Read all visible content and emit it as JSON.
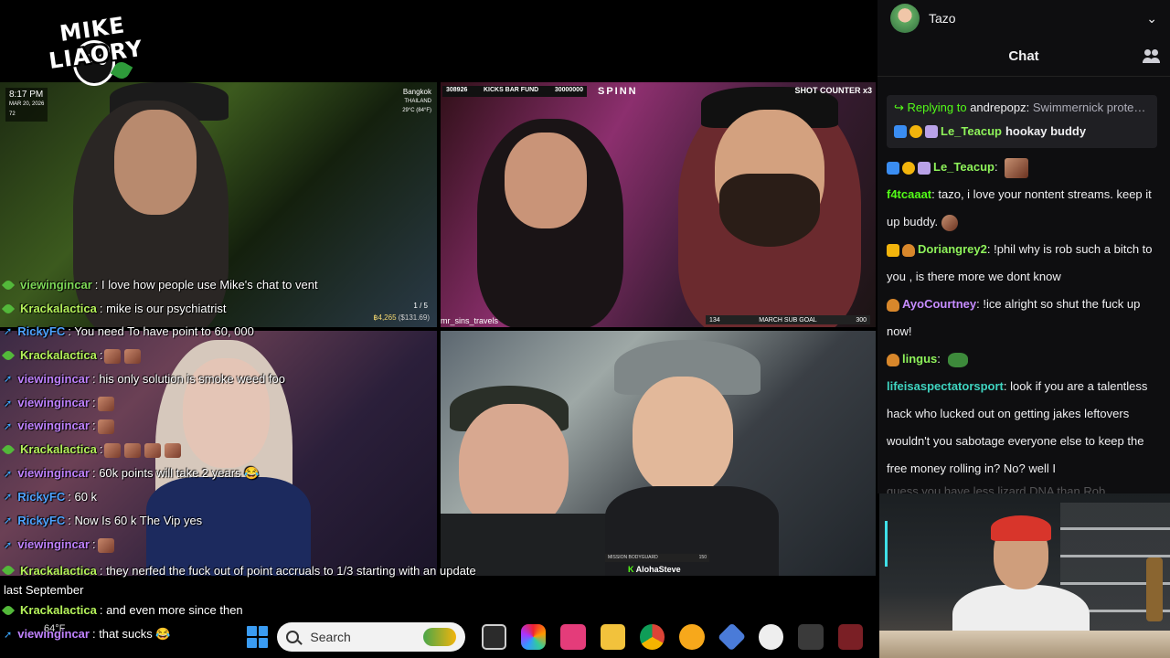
{
  "logo": {
    "text": "MIKE LIAORY"
  },
  "feed1": {
    "time": "8:17 PM",
    "date": "MAR 20, 2026",
    "viewers": "72",
    "city": "Bangkok",
    "country": "THAILAND",
    "temp": "29°C (84°F)",
    "pages": "1 / 5",
    "money": "฿4,265",
    "money_usd": "($131.69)"
  },
  "feed2": {
    "fund_num": "308926",
    "fund_label": "KICKS BAR FUND",
    "fund_goal": "30000000",
    "sign": "SPINN",
    "shot_counter": "SHOT COUNTER  x3",
    "handle": "mr_sins_travels",
    "subgoal_left": "134",
    "subgoal_label": "MARCH SUB GOAL",
    "subgoal_right": "300"
  },
  "feed4": {
    "mission_label": "MISSION BODYGUARD",
    "mission_val": "150",
    "streamer": "AlohaSteve"
  },
  "overlay_chat": [
    {
      "user": "viewingincar",
      "text": ": I love how people use Mike's chat to vent",
      "color": "u-green",
      "icon": "leaf"
    },
    {
      "user": "Krackalactica",
      "text": ": mike is our psychiatrist",
      "color": "u-lime",
      "icon": "leaf"
    },
    {
      "user": "RickyFC",
      "text": ": You need To have point to 60, 000",
      "color": "u-blue",
      "icon": "arrow"
    },
    {
      "user": "Krackalactica",
      "text": ":",
      "color": "u-lime",
      "icon": "leaf"
    },
    {
      "user": "viewingincar",
      "text": ": his only solution is smoke weed foo",
      "color": "u-purple",
      "icon": "arrow"
    },
    {
      "user": "viewingincar",
      "text": ":",
      "color": "u-purple",
      "icon": "arrow"
    },
    {
      "user": "viewingincar",
      "text": ":",
      "color": "u-purple",
      "icon": "arrow"
    },
    {
      "user": "Krackalactica",
      "text": ":",
      "color": "u-lime",
      "icon": "leaf"
    },
    {
      "user": "viewingincar",
      "text": ": 60k points will take 2 years 😂",
      "color": "u-purple",
      "icon": "arrow"
    },
    {
      "user": "RickyFC",
      "text": ": 60 k",
      "color": "u-blue",
      "icon": "arrow"
    },
    {
      "user": "RickyFC",
      "text": ": Now Is 60 k The Vip yes",
      "color": "u-blue",
      "icon": "arrow"
    },
    {
      "user": "viewingincar",
      "text": ":",
      "color": "u-purple",
      "icon": "arrow"
    },
    {
      "user": "Krackalactica",
      "text": ": they nerfed the fuck out of point accruals to 1/3 starting with an update last September",
      "color": "u-lime",
      "icon": "leaf"
    },
    {
      "user": "Krackalactica",
      "text": ": and even more since then",
      "color": "u-lime",
      "icon": "leaf"
    },
    {
      "user": "viewingincar",
      "text": ": that sucks 😂",
      "color": "u-purple",
      "icon": "arrow"
    }
  ],
  "weather": {
    "temp": "64°F"
  },
  "taskbar": {
    "search_placeholder": "Search"
  },
  "chat": {
    "account_name": "Tazo",
    "title": "Chat",
    "reply_prefix": "Replying to",
    "reply_to": "andrepopz:",
    "reply_ref": "Swimmernick protects...",
    "reply_user": "Le_Teacup",
    "reply_text": "hookay buddy",
    "messages": [
      {
        "user": "Le_Teacup",
        "text": "",
        "color": "n-lime"
      },
      {
        "user": "f4tcaaat",
        "text": "tazo, i love your nontent streams. keep it up buddy.",
        "color": "n-green"
      },
      {
        "user": "Doriangrey2",
        "text": "!phil why is rob such a bitch to you , is there more we dont know",
        "color": "n-lime"
      },
      {
        "user": "AyoCourtney",
        "text": "!ice alright so shut the fuck up now!",
        "color": "n-purple"
      },
      {
        "user": "lingus",
        "text": "",
        "color": "n-lime"
      },
      {
        "user": "lifeisaspectatorsport",
        "text": "look if you are a talentless hack who lucked out on getting jakes leftovers wouldn't you sabotage everyone else to keep the free money rolling in? No? well I",
        "color": "n-teal"
      }
    ],
    "faded": "guess you have less lizard DNA than Rob"
  }
}
